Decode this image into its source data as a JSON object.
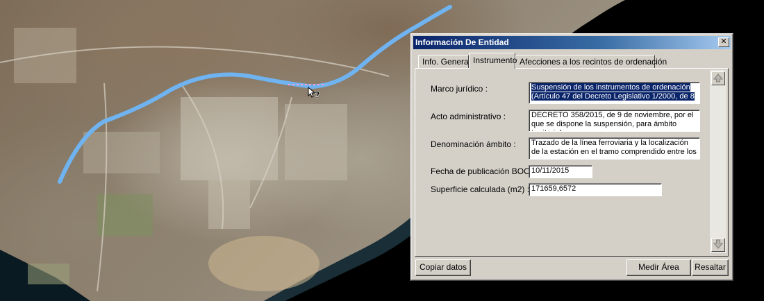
{
  "dialog": {
    "title": "Información De Entidad",
    "close_glyph": "✕",
    "tabs": [
      {
        "label": "Info. General"
      },
      {
        "label": "Instrumento"
      },
      {
        "label": "Afecciones a los recintos de ordenación"
      }
    ],
    "fields": {
      "marco": {
        "label": "Marco jurídico :",
        "value": "Suspensión de los instrumentos de ordenación (Artículo 47 del Decreto Legislativo 1/2000, de 8"
      },
      "acto": {
        "label": "Acto administrativo :",
        "value": "DECRETO 358/2015, de 9 de noviembre, por el que se dispone la suspensión, para ámbito territorial"
      },
      "denominacion": {
        "label": "Denominación ámbito :",
        "value": "Trazado de la línea ferroviaria y la localización de la estación en el tramo comprendido entre los"
      },
      "fecha": {
        "label": "Fecha de publicación BOC :",
        "value": "10/11/2015"
      },
      "superficie": {
        "label": "Superficie calculada (m2) :",
        "value": "171659,6572"
      }
    },
    "scroll_up_icon": "arrow-up-icon",
    "scroll_down_icon": "arrow-down-icon",
    "buttons": {
      "copy": "Copiar datos",
      "measure": "Medir Área",
      "highlight": "Resaltar"
    }
  },
  "map": {
    "route_color": "#6fb3f0",
    "sea_color": "#000000",
    "cursor_icon": "help-cursor-icon",
    "cursor_glyph": "?"
  }
}
